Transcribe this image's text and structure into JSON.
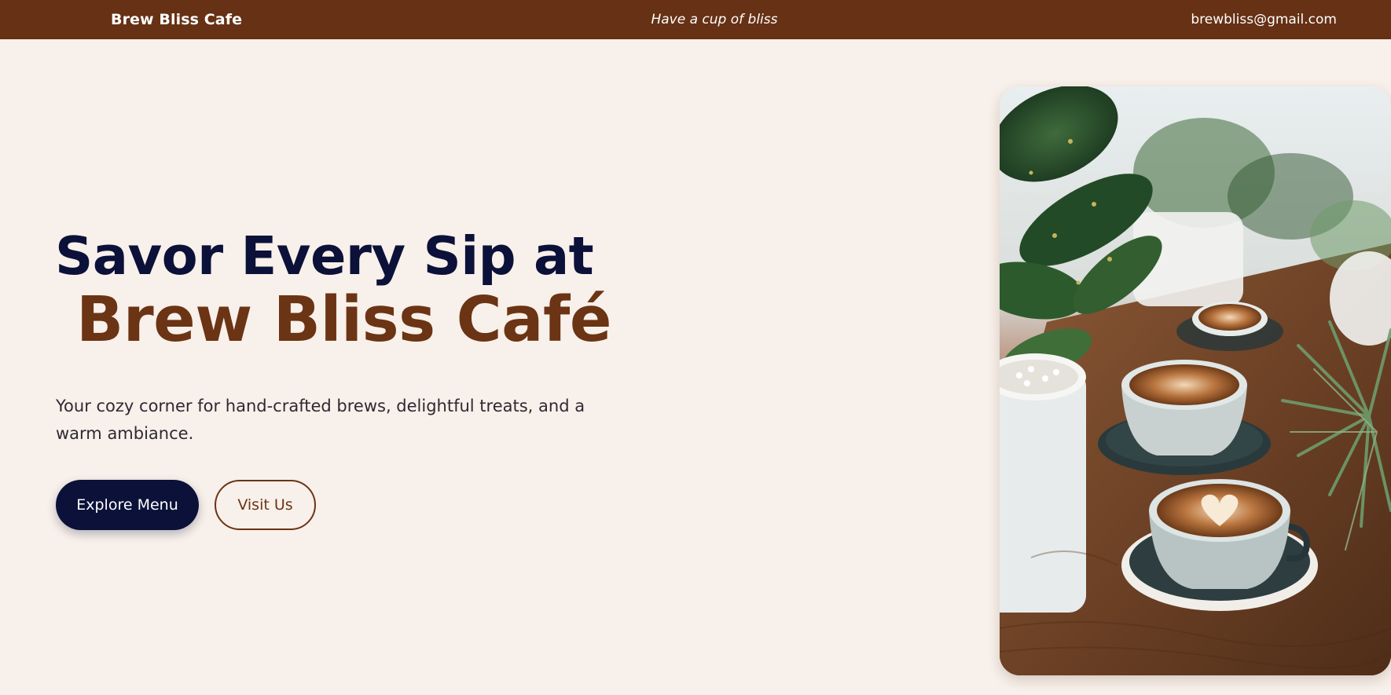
{
  "header": {
    "brand": "Brew Bliss Cafe",
    "tagline": "Have a cup of bliss",
    "email": "brewbliss@gmail.com",
    "background_color": "#663114"
  },
  "hero": {
    "title_line1": "Savor Every Sip at",
    "title_line2": "Brew Bliss Café",
    "description": "Your cozy corner for hand-crafted brews, delightful treats, and a warm ambiance.",
    "primary_button_label": "Explore Menu",
    "secondary_button_label": "Visit Us",
    "image_subject": "latte-art-cups-with-plants"
  },
  "colors": {
    "page_background": "#f8f0ea",
    "navy": "#0b1138",
    "brown": "#6b3414"
  }
}
